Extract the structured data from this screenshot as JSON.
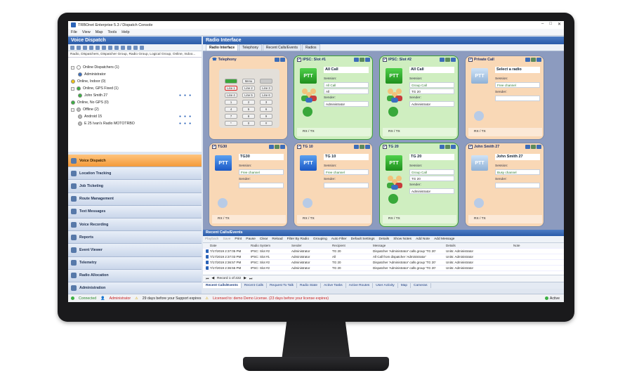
{
  "window": {
    "title": "TRBOnet Enterprise 5.3 / Dispatch Console",
    "controls": [
      "–",
      "□",
      "✕"
    ]
  },
  "menu": [
    "File",
    "View",
    "Map",
    "Tools",
    "Help"
  ],
  "left_panel": {
    "title": "Voice Dispatch",
    "filter_text": "Radio, Dispatchers, Dispatcher Group, Radio Group, Logical Group, Online, Indoo...",
    "tree": [
      {
        "label": "Online Dispatchers (1)",
        "color": "#ffffff",
        "level": 0,
        "expander": "−"
      },
      {
        "label": "Administrator",
        "color": "#3a6fc0",
        "level": 1
      },
      {
        "label": "Online, Indoor (0)",
        "color": "#f0c419",
        "level": 0
      },
      {
        "label": "Online, GPS Fixed (1)",
        "color": "#3cb043",
        "level": 0,
        "expander": "−"
      },
      {
        "label": "John Smith 27",
        "color": "#3cb043",
        "level": 1,
        "icons": true
      },
      {
        "label": "Online, No GPS (0)",
        "color": "#3cb043",
        "level": 0
      },
      {
        "label": "Offline (2)",
        "color": "#bbbbbb",
        "level": 0,
        "expander": "−"
      },
      {
        "label": "Android 15",
        "color": "#bbbbbb",
        "level": 1,
        "icons": true
      },
      {
        "label": "E 25 Ivan's Radio MOTOTRBO",
        "color": "#bbbbbb",
        "level": 1,
        "icons": true
      }
    ],
    "nav": [
      {
        "label": "Voice Dispatch",
        "active": true
      },
      {
        "label": "Location Tracking"
      },
      {
        "label": "Job Ticketing"
      },
      {
        "label": "Route Management"
      },
      {
        "label": "Text Messages"
      },
      {
        "label": "Voice Recording"
      },
      {
        "label": "Reports"
      },
      {
        "label": "Event Viewer"
      },
      {
        "label": "Telemetry"
      },
      {
        "label": "Radio Allocation"
      },
      {
        "label": "Administration"
      }
    ]
  },
  "right_panel": {
    "title": "Radio Interface",
    "tabs": [
      "Radio Interface",
      "Telephony",
      "Recent Calls/Events",
      "Radios"
    ],
    "telephony": {
      "title": "Telephony",
      "keys": [
        [
          "",
          "Menu",
          ""
        ],
        [
          "Line 1",
          "Line 2",
          "Line 3"
        ],
        [
          "Line 4",
          "Line 5",
          "Line 6"
        ],
        [
          "1",
          "2",
          "3"
        ],
        [
          "4",
          "5",
          "6"
        ],
        [
          "7",
          "8",
          "9"
        ],
        [
          "*",
          "0",
          "#"
        ]
      ]
    },
    "cards": [
      {
        "title": "IPSC: Slot #1",
        "theme": "green",
        "ptt": "green",
        "group": "All Call",
        "session_label": "Session:",
        "session": "All Call",
        "session2": "All",
        "sender_label": "Sender:",
        "sender": "Administrator",
        "rxtx": "RX / TX",
        "people": true
      },
      {
        "title": "IPSC: Slot #2",
        "theme": "green",
        "ptt": "green",
        "group": "All Call",
        "session_label": "Session:",
        "session": "Group Call",
        "session2": "TG 20",
        "sender_label": "Sender:",
        "sender": "Administrator",
        "rxtx": "RX / TX",
        "people": true
      },
      {
        "title": "Private Call",
        "theme": "orange",
        "ptt": "grey",
        "group": "Select a radio",
        "session_label": "Session:",
        "session": "Free channel",
        "session2": "",
        "sender_label": "Sender:",
        "sender": "",
        "rxtx": "RX / TX"
      },
      {
        "title": "TG30",
        "theme": "orange",
        "ptt": "blue",
        "group": "TG30",
        "session_label": "Session:",
        "session": "Free channel",
        "session2": "",
        "sender_label": "Sender:",
        "sender": "",
        "rxtx": "RX / TX"
      },
      {
        "title": "TG 10",
        "theme": "orange",
        "ptt": "blue",
        "group": "TG 10",
        "session_label": "Session:",
        "session": "Free channel",
        "session2": "",
        "sender_label": "Sender:",
        "sender": "",
        "rxtx": "RX / TX"
      },
      {
        "title": "TG 20",
        "theme": "green",
        "ptt": "green",
        "group": "TG 20",
        "session_label": "Session:",
        "session": "Group Call",
        "session2": "TG 20",
        "sender_label": "Sender:",
        "sender": "Administrator",
        "rxtx": "RX / TX",
        "people": true
      },
      {
        "title": "John Smith 27",
        "theme": "orange",
        "ptt": "grey",
        "group": "John Smith 27",
        "session_label": "Session:",
        "session": "Busy channel",
        "session2": "",
        "sender_label": "Sender:",
        "sender": "",
        "rxtx": "RX / TX"
      }
    ]
  },
  "events": {
    "title": "Recent Calls/Events",
    "toolbar": [
      "Playback",
      "Save",
      "Print",
      "Pause",
      "Clear",
      "Reload",
      "Filter By Radio",
      "Grouping",
      "Auto Filter",
      "Default Settings",
      "Details",
      "Show Notes",
      "Add Note",
      "Add Message"
    ],
    "columns": [
      "Date",
      "Radio System",
      "Sender",
      "Recipient",
      "Message",
      "Details",
      "Note"
    ],
    "rows": [
      [
        "7/17/2019 2:37:05 PM",
        "IPSC: Slot #2",
        "Administrator",
        "TG 20",
        "Dispatcher 'Administrator' calls group 'TG 20'",
        "Units: Administrator",
        ""
      ],
      [
        "7/17/2019 2:37:03 PM",
        "IPSC: Slot #1",
        "Administrator",
        "All",
        "All Call from dispatcher 'Administrator'",
        "Units: Administrator",
        ""
      ],
      [
        "7/17/2019 2:36:57 PM",
        "IPSC: Slot #2",
        "Administrator",
        "TG 20",
        "Dispatcher 'Administrator' calls group 'TG 20'",
        "Units: Administrator",
        ""
      ],
      [
        "7/17/2019 2:36:55 PM",
        "IPSC: Slot #2",
        "Administrator",
        "TG 20",
        "Dispatcher 'Administrator' calls group 'TG 20'",
        "Units: Administrator",
        ""
      ]
    ],
    "pager": "Record 1 of 222",
    "bottom_tabs": [
      "Recent Calls/Events",
      "Recent Calls",
      "Request To Talk",
      "Radio State",
      "Active Tasks",
      "Active Routes",
      "User Activity",
      "Map",
      "Cameras"
    ]
  },
  "status": {
    "connected": "Connected",
    "user": "Administrator",
    "support": "29 days before your Support expires",
    "license": "Licensed to: demo Demo License. (23 days before your license expires)",
    "active": "Active"
  }
}
